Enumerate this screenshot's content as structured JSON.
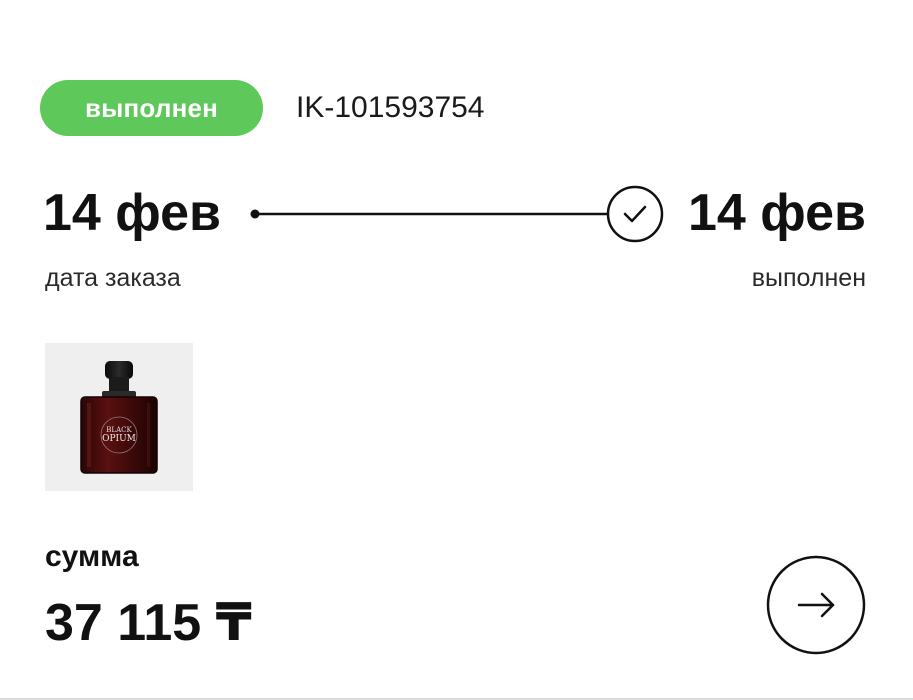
{
  "order": {
    "status_label": "выполнен",
    "order_id": "IK-101593754",
    "status_color": "#5ec85a"
  },
  "timeline": {
    "start_date": "14 фев",
    "start_caption": "дата заказа",
    "end_date": "14 фев",
    "end_caption": "выполнен",
    "end_icon": "check-icon"
  },
  "product": {
    "image": "perfume-bottle-thumbnail",
    "bottle_text_line1": "BLACK",
    "bottle_text_line2": "OPIUM"
  },
  "summary": {
    "label": "сумма",
    "amount": "37 115 ₸"
  },
  "actions": {
    "next_icon": "arrow-right-icon"
  }
}
